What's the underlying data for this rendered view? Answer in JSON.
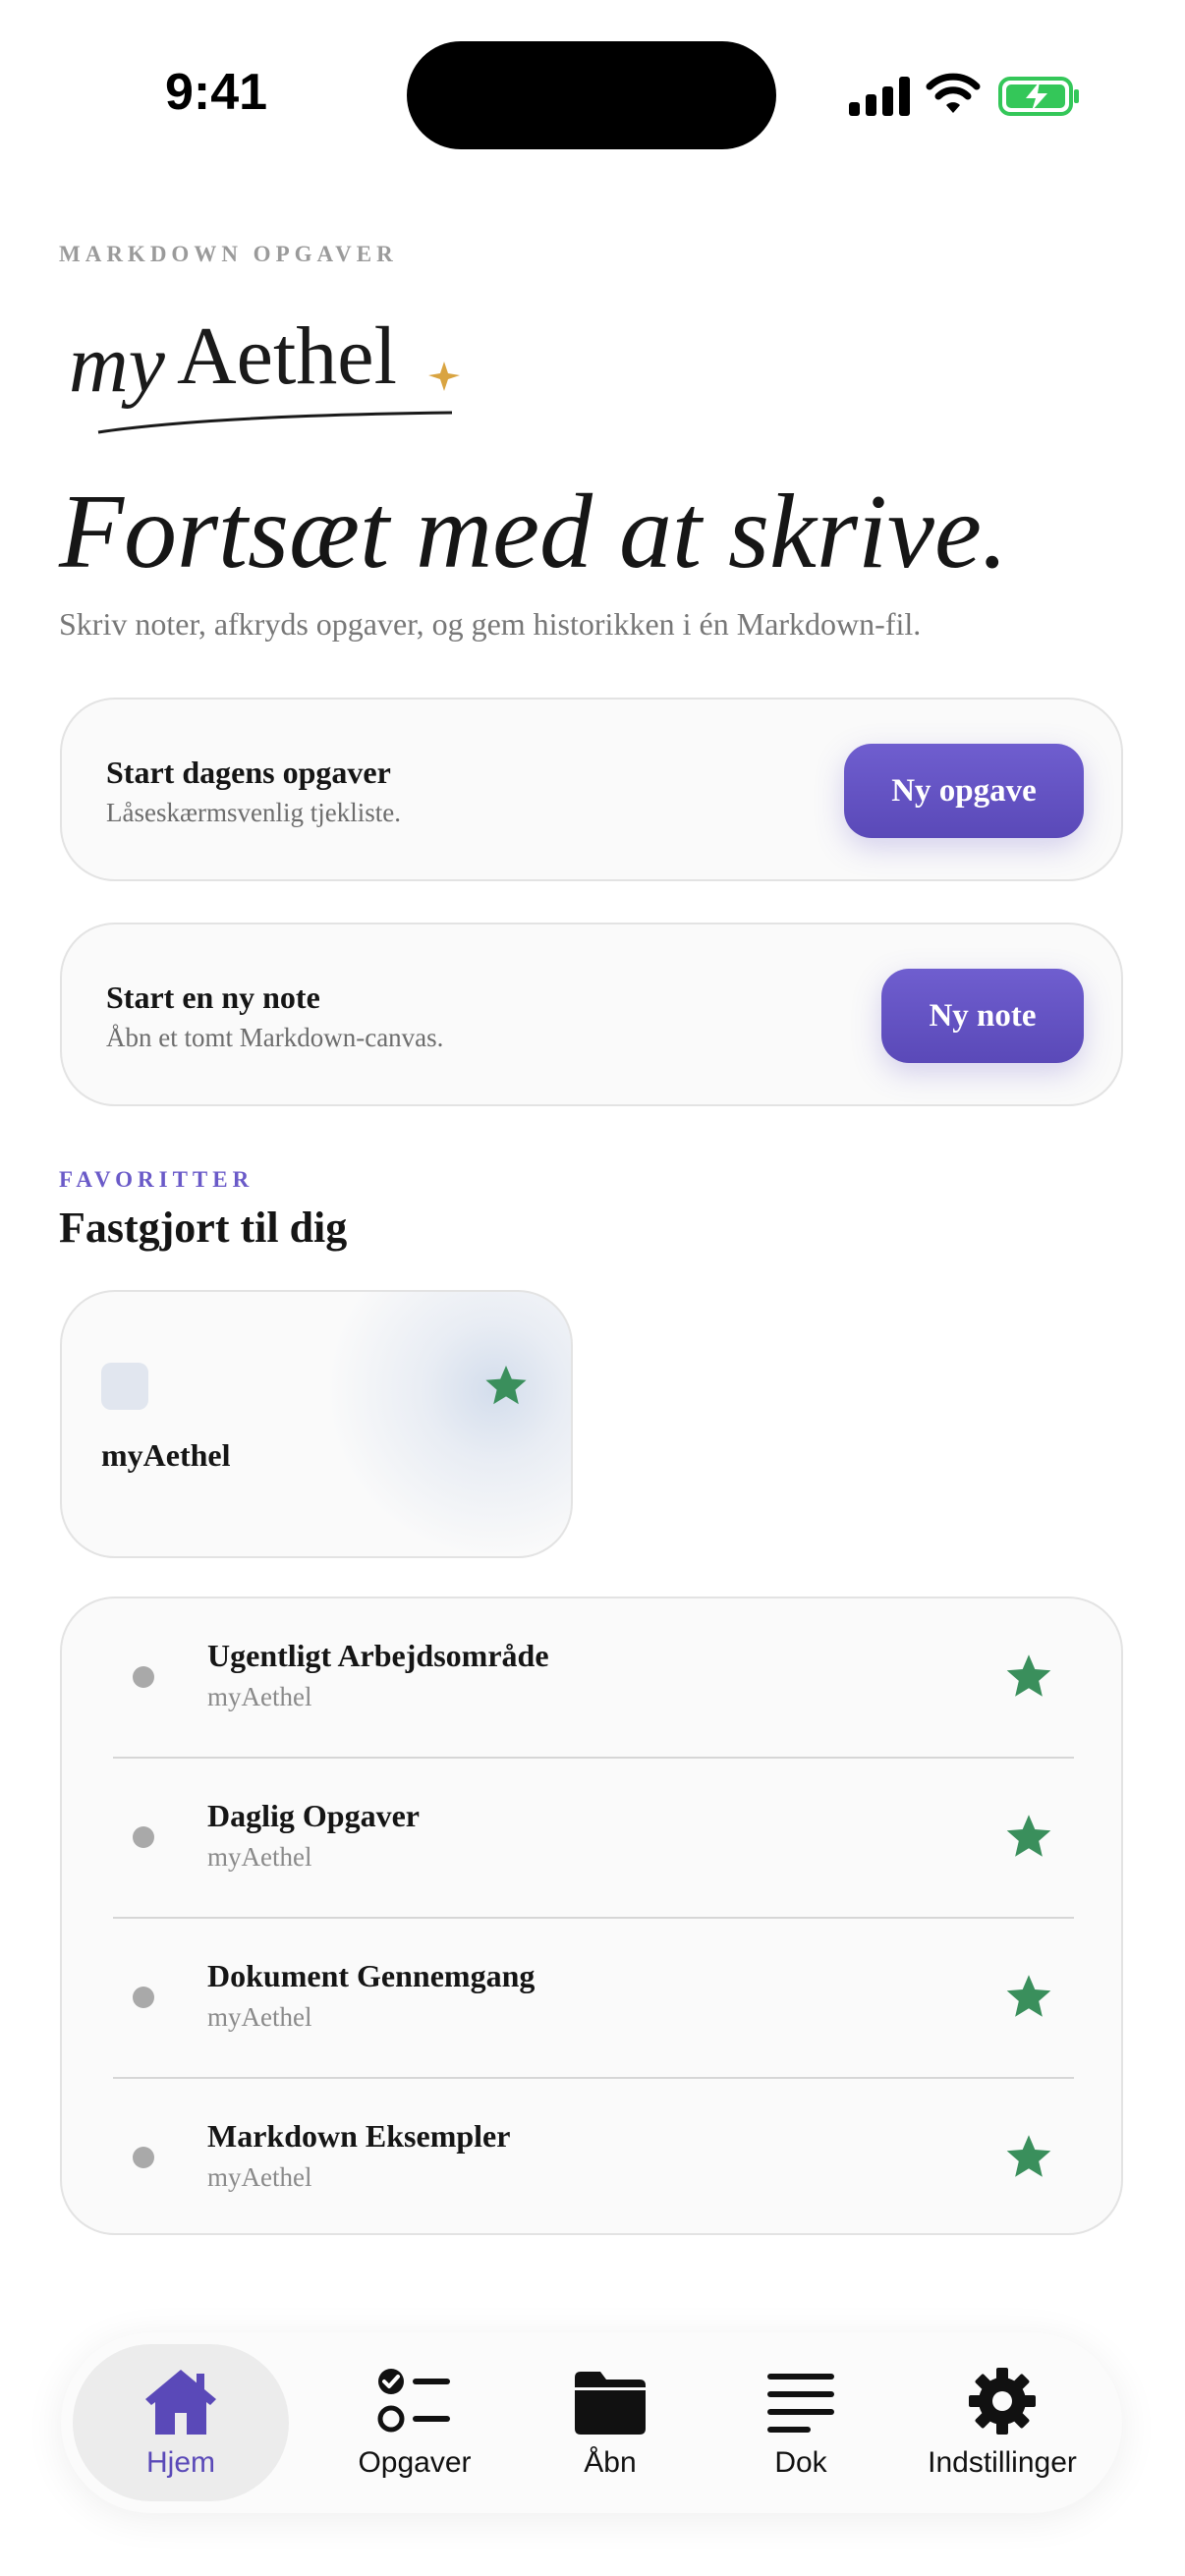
{
  "status": {
    "time": "9:41"
  },
  "header": {
    "eyebrow": "MARKDOWN OPGAVER",
    "logo_text": "myAethel",
    "headline": "Fortsæt med at skrive.",
    "subtitle": "Skriv noter, afkryds opgaver, og gem historikken i én Markdown-fil."
  },
  "actions": [
    {
      "title": "Start dagens opgaver",
      "subtitle": "Låseskærmsvenlig tjekliste.",
      "button": "Ny opgave"
    },
    {
      "title": "Start en ny note",
      "subtitle": "Åbn et tomt Markdown-canvas.",
      "button": "Ny note"
    }
  ],
  "favorites": {
    "eyebrow": "FAVORITTER",
    "title": "Fastgjort til dig",
    "pinned": {
      "label": "myAethel",
      "starred": true
    },
    "items": [
      {
        "title": "Ugentligt Arbejdsområde",
        "subtitle": "myAethel",
        "starred": true
      },
      {
        "title": "Daglig Opgaver",
        "subtitle": "myAethel",
        "starred": true
      },
      {
        "title": "Dokument Gennemgang",
        "subtitle": "myAethel",
        "starred": true
      },
      {
        "title": "Markdown Eksempler",
        "subtitle": "myAethel",
        "starred": true
      }
    ]
  },
  "tabs": [
    {
      "label": "Hjem",
      "icon": "house-icon",
      "active": true
    },
    {
      "label": "Opgaver",
      "icon": "checklist-icon",
      "active": false
    },
    {
      "label": "Åbn",
      "icon": "folder-icon",
      "active": false
    },
    {
      "label": "Dok",
      "icon": "document-lines-icon",
      "active": false
    },
    {
      "label": "Indstillinger",
      "icon": "gear-icon",
      "active": false
    }
  ],
  "colors": {
    "accent": "#5a49b8",
    "star": "#3a8f5c",
    "battery": "#34c759"
  }
}
